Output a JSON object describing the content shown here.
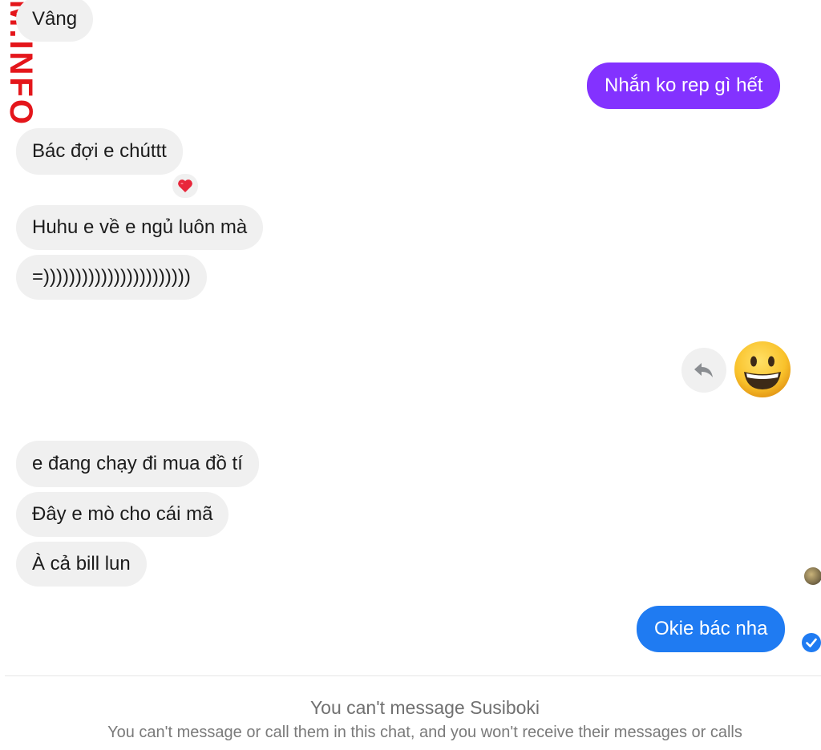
{
  "watermark": "M.INFO",
  "messages": {
    "m1": "Vâng",
    "m2": "Nhắn ko rep gì hết",
    "m3": "Bác đợi e chúttt",
    "m4": "Huhu e về e ngủ luôn mà",
    "m5": "=)))))))))))))))))))))))",
    "m6": "e đang chạy đi mua đồ tí",
    "m7": "Đây e mò cho cái mã",
    "m8": "À cả bill lun",
    "m9": "Okie bác nha"
  },
  "reaction": {
    "icon": "heart-icon",
    "emoji": "❤️"
  },
  "big_emoji": {
    "icon": "grinning-face-icon"
  },
  "blocked": {
    "title": "You can't message Susiboki",
    "subtitle": "You can't message or call them in this chat, and you won't receive their messages or calls"
  },
  "colors": {
    "incoming_bubble": "#f0f0f0",
    "outgoing_purple": "#8332ff",
    "outgoing_blue": "#1f7bf2",
    "watermark": "#e4161b"
  }
}
